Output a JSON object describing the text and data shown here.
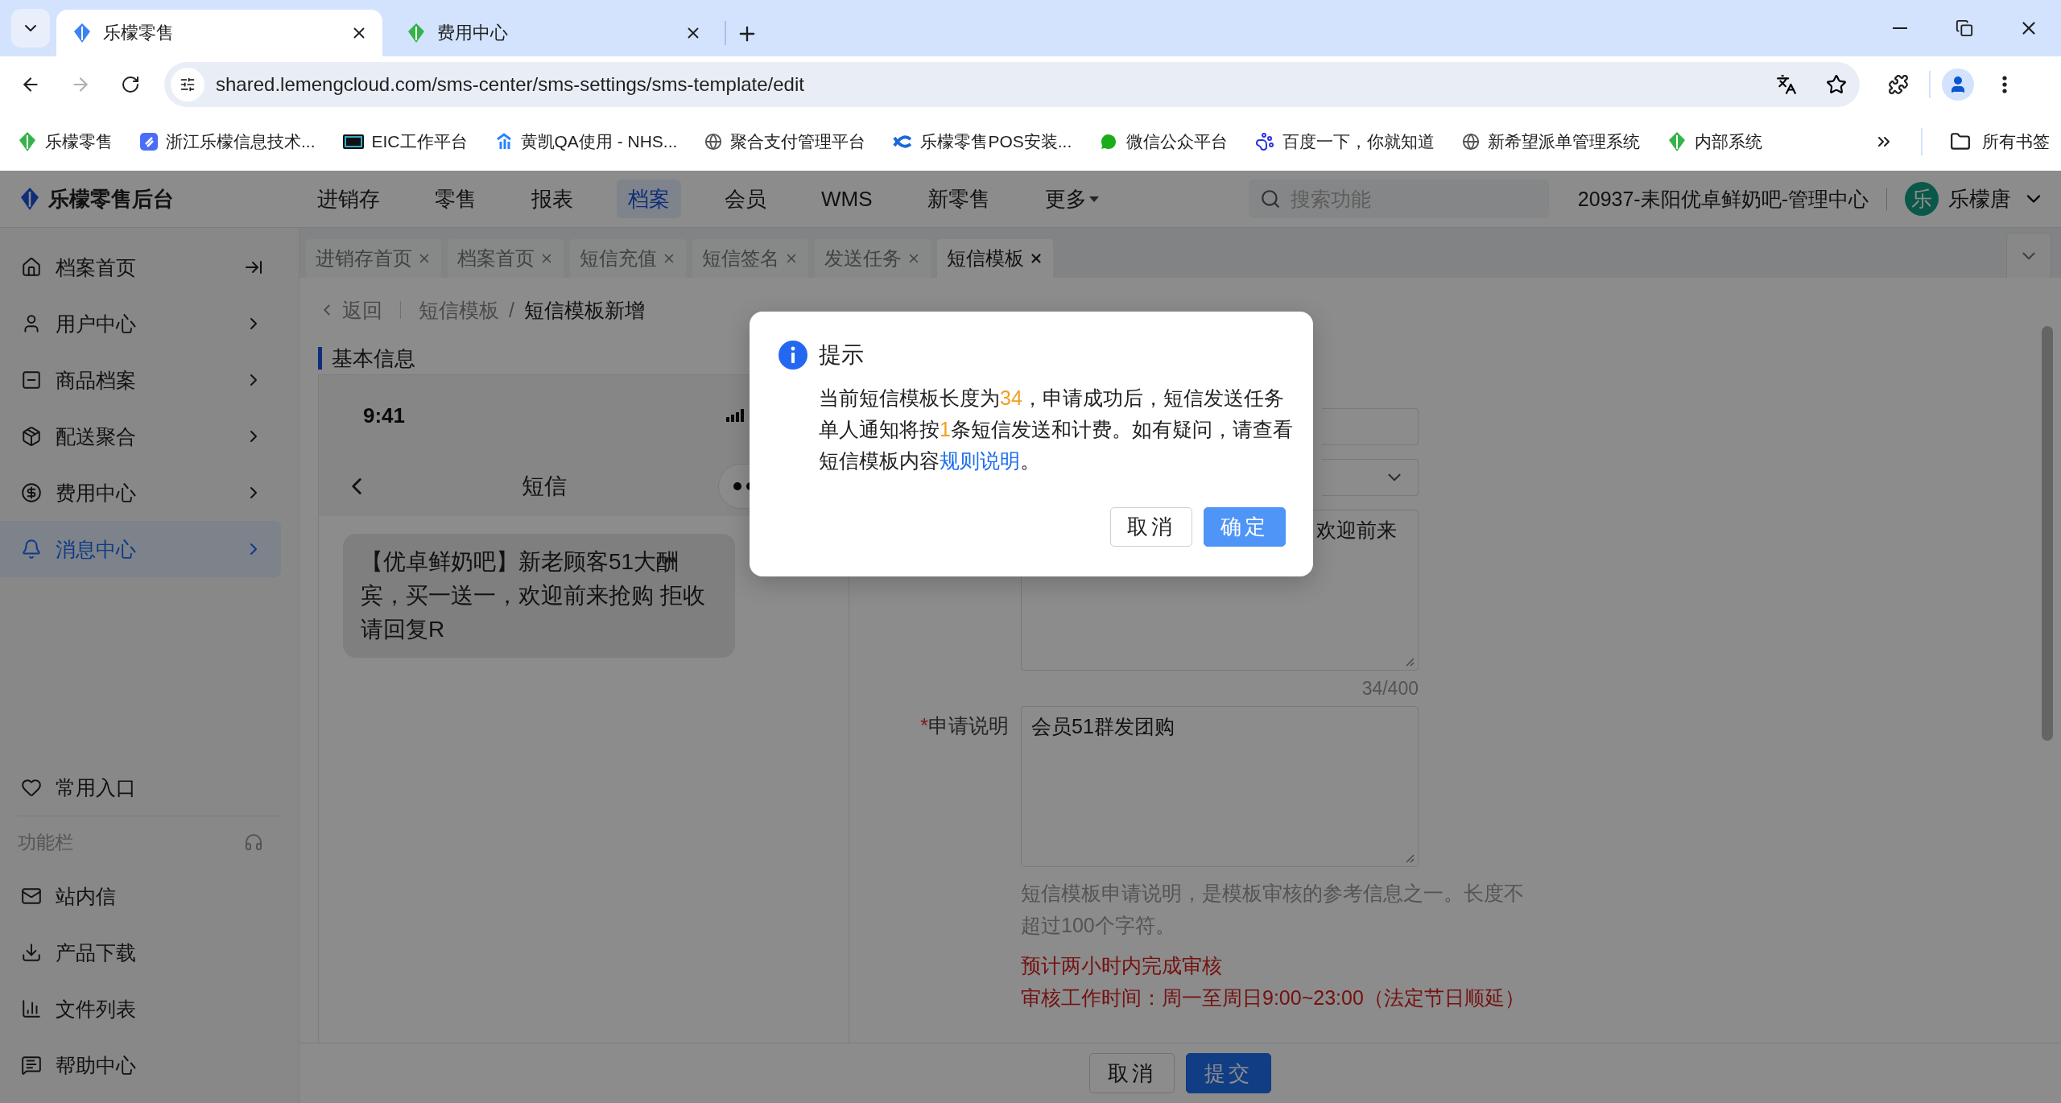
{
  "browser": {
    "tabs": [
      {
        "title": "乐檬零售",
        "selected": true
      },
      {
        "title": "费用中心",
        "selected": false
      }
    ],
    "address": "shared.lemengcloud.com/sms-center/sms-settings/sms-template/edit",
    "bookmarks": [
      "乐檬零售",
      "浙江乐檬信息技术...",
      "EIC工作平台",
      "黄凯QA使用 - NHS...",
      "聚合支付管理平台",
      "乐檬零售POS安装...",
      "微信公众平台",
      "百度一下，你就知道",
      "新希望派单管理系统",
      "内部系统"
    ],
    "all_bookmarks": "所有书签"
  },
  "header": {
    "brand": "乐檬零售后台",
    "nav": [
      {
        "label": "进销存",
        "selected": false
      },
      {
        "label": "零售",
        "selected": false
      },
      {
        "label": "报表",
        "selected": false
      },
      {
        "label": "档案",
        "selected": true
      },
      {
        "label": "会员",
        "selected": false
      },
      {
        "label": "WMS",
        "selected": false
      },
      {
        "label": "新零售",
        "selected": false
      }
    ],
    "more": "更多",
    "search_placeholder": "搜索功能",
    "store": "20937-耒阳优卓鲜奶吧-管理中心",
    "user": {
      "avatar": "乐",
      "name": "乐檬唐"
    }
  },
  "sidebar": {
    "items": [
      {
        "label": "档案首页",
        "kind": "collapse",
        "selected": false
      },
      {
        "label": "用户中心",
        "kind": "menu",
        "selected": false
      },
      {
        "label": "商品档案",
        "kind": "menu",
        "selected": false
      },
      {
        "label": "配送聚合",
        "kind": "menu",
        "selected": false
      },
      {
        "label": "费用中心",
        "kind": "menu",
        "selected": false
      },
      {
        "label": "消息中心",
        "kind": "menu",
        "selected": true
      }
    ],
    "favorites": "常用入口",
    "section": "功能栏",
    "tools": [
      "站内信",
      "产品下载",
      "文件列表",
      "帮助中心"
    ]
  },
  "page_tabs": [
    {
      "label": "进销存首页",
      "selected": false
    },
    {
      "label": "档案首页",
      "selected": false
    },
    {
      "label": "短信充值",
      "selected": false
    },
    {
      "label": "短信签名",
      "selected": false
    },
    {
      "label": "发送任务",
      "selected": false
    },
    {
      "label": "短信模板",
      "selected": true
    }
  ],
  "breadcrumb": {
    "back": "返回",
    "separator": "/",
    "path": [
      "短信模板",
      "短信模板新增"
    ]
  },
  "section_title": "基本信息",
  "preview": {
    "time": "9:41",
    "title": "短信",
    "message": "【优卓鲜奶吧】新老顾客51大酬宾，买一送一，欢迎前来抢购 拒收请回复R"
  },
  "form": {
    "content_visible": "欢迎前来",
    "counter": "34/400",
    "reason": {
      "required_mark": "*",
      "label": "申请说明",
      "value": "会员51群发团购"
    },
    "hint": "短信模板申请说明，是模板审核的参考信息之一。长度不超过100个字符。",
    "notices": [
      "预计两小时内完成审核",
      "审核工作时间：周一至周日9:00~23:00（法定节日顺延）"
    ]
  },
  "footer": {
    "buttons": [
      {
        "label": "取消",
        "kind": "default"
      },
      {
        "label": "提交",
        "kind": "primary"
      }
    ]
  },
  "dialog": {
    "title": "提示",
    "message": [
      {
        "kind": "text",
        "text": "当前短信模板长度为"
      },
      {
        "kind": "number",
        "text": "34"
      },
      {
        "kind": "text",
        "text": "，申请成功后，短信发送任务单人通知将按"
      },
      {
        "kind": "number",
        "text": "1"
      },
      {
        "kind": "text",
        "text": "条短信发送和计费。如有疑问，请查看短信模板内容"
      },
      {
        "kind": "link",
        "text": "规则说明"
      },
      {
        "kind": "text",
        "text": "。"
      }
    ],
    "buttons": [
      {
        "label": "取消",
        "kind": "default"
      },
      {
        "label": "确定",
        "kind": "primary"
      }
    ]
  }
}
